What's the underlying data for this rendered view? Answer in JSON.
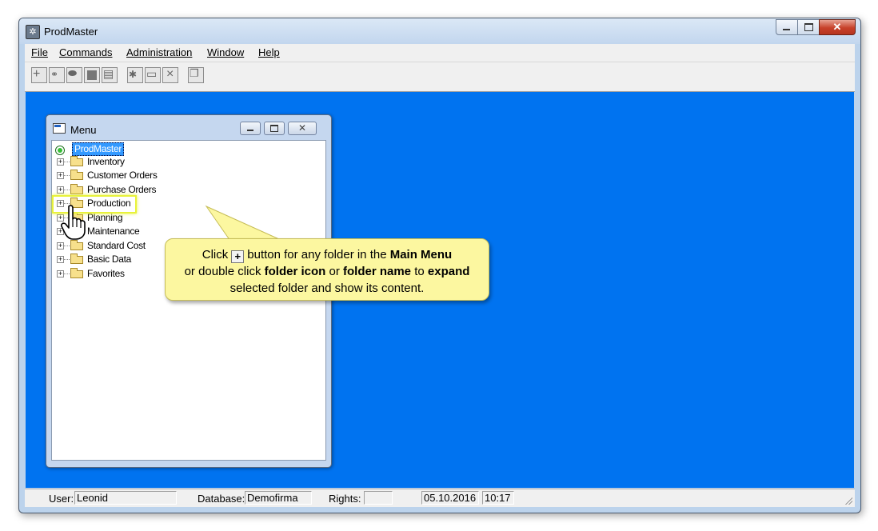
{
  "app": {
    "title": "ProdMaster"
  },
  "menubar": [
    {
      "label": "File"
    },
    {
      "label": "Commands"
    },
    {
      "label": "Administration"
    },
    {
      "label": "Window"
    },
    {
      "label": "Help"
    }
  ],
  "toolbar_icons": [
    "new-record-icon",
    "binoculars-icon",
    "eraser-icon",
    "stop-icon",
    "document-icon",
    "new-folder-icon",
    "folder-icon",
    "delete-icon",
    "copy-icon"
  ],
  "menu_window": {
    "title": "Menu",
    "tree": {
      "root": "ProdMaster",
      "folders": [
        "Inventory",
        "Customer Orders",
        "Purchase Orders",
        "Production",
        "Planning",
        "Maintenance",
        "Standard Cost",
        "Basic Data",
        "Favorites"
      ],
      "highlighted": "Production"
    }
  },
  "callout": {
    "p1": "Click",
    "p2": "button for any folder in the",
    "b1": "Main Menu",
    "p3": "or double click",
    "b2": "folder icon",
    "p4": "or",
    "b3": "folder name",
    "p5": "to",
    "b4": "expand",
    "p6": "selected folder and show its content."
  },
  "status": {
    "user_label": "User:",
    "user": "Leonid",
    "database_label": "Database:",
    "database": "Demofirma",
    "rights_label": "Rights:",
    "rights": "",
    "date": "05.10.2016",
    "time": "10:17"
  },
  "colors": {
    "mdi_background": "#0073f0",
    "callout_fill": "#fcf7a0",
    "highlight": "#e8f23a",
    "selection": "#3399ff"
  }
}
